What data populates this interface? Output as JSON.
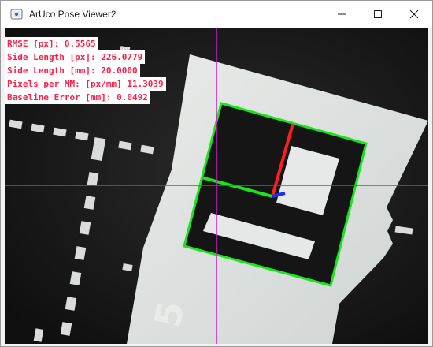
{
  "window": {
    "title": "ArUco Pose Viewer2"
  },
  "overlay": {
    "rmse_label": "RMSE [px]: 0.5565",
    "side_px_label": "Side Length [px]: 226.0779",
    "side_mm_label": "Side Length [mm]: 20.0000",
    "ppm_label": "Pixels per MM: [px/mm] 11.3039",
    "baseline_label": "Baseline Error [mm]: 0.0492"
  },
  "scene": {
    "marker_digit": "5"
  },
  "colors": {
    "marker_outline": "#19e619",
    "crosshair": "#c81ec8",
    "axis_x": "#ff1e1e",
    "axis_y": "#19e619",
    "axis_z": "#1432ff",
    "hud_text": "#ff1e46"
  }
}
